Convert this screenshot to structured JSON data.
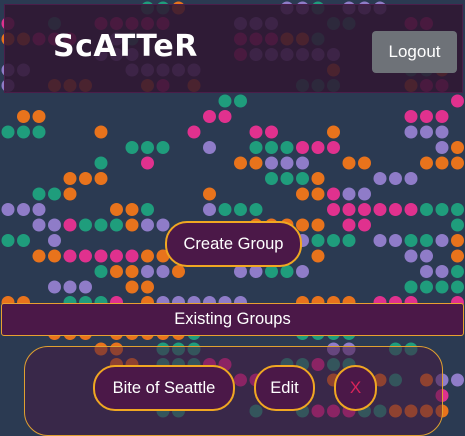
{
  "header": {
    "logo_text": "ScATTeR",
    "logout_label": "Logout"
  },
  "actions": {
    "create_group_label": "Create Group"
  },
  "existing_groups": {
    "heading": "Existing Groups",
    "groups": [
      {
        "name": "Bite of Seattle",
        "edit_label": "Edit",
        "delete_label": "X"
      }
    ]
  },
  "colors": {
    "background": "#2b3a52",
    "accent_border": "#f0a722",
    "button_fill": "#4b1848",
    "dot_palette": [
      "#e8731c",
      "#e0318e",
      "#8f7cc8",
      "#1f9d7c"
    ]
  }
}
